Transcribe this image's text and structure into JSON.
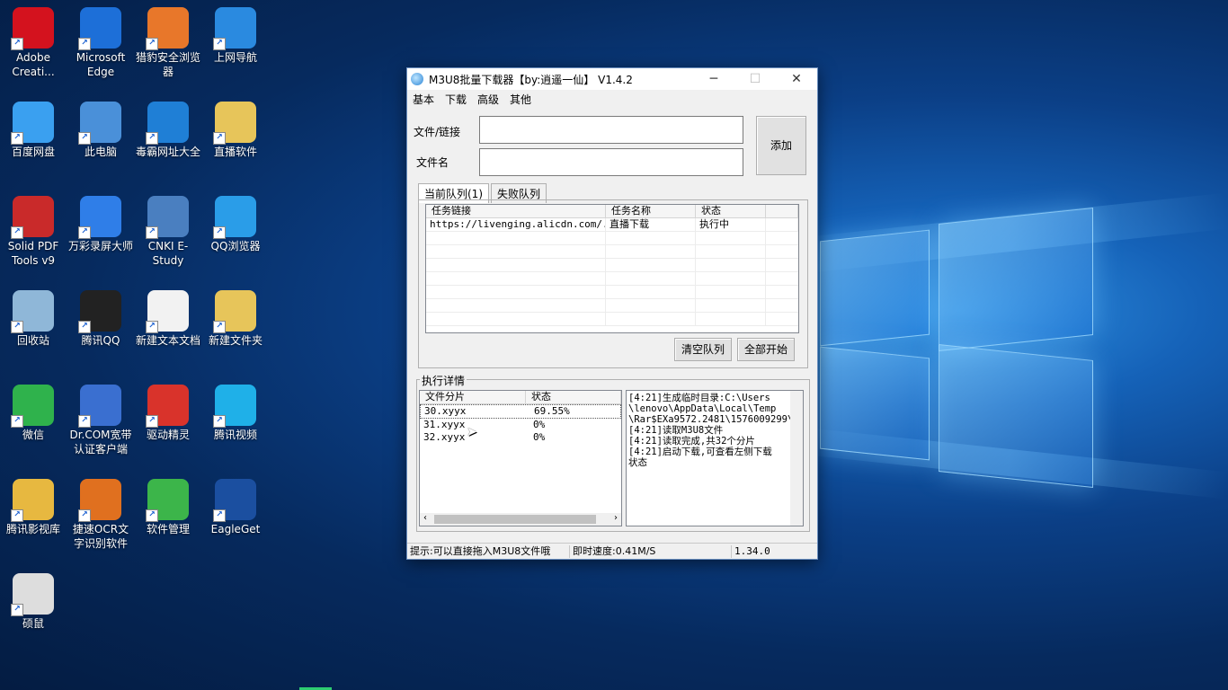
{
  "desktop": {
    "icons": [
      {
        "label": "Adobe Creati...",
        "icon": "adobe-cc-icon",
        "color": "#d4121e"
      },
      {
        "label": "Microsoft Edge",
        "icon": "edge-icon",
        "color": "#1d6fd8"
      },
      {
        "label": "猎豹安全浏览器",
        "icon": "cheetah-browser-icon",
        "color": "#e8772a"
      },
      {
        "label": "上网导航",
        "icon": "ie-icon",
        "color": "#2a8ae0"
      },
      {
        "label": "百度网盘",
        "icon": "baidu-netdisk-icon",
        "color": "#3aa0f0"
      },
      {
        "label": "此电脑",
        "icon": "computer-icon",
        "color": "#4a90d9"
      },
      {
        "label": "毒霸网址大全",
        "icon": "ie-icon",
        "color": "#1f7fd6"
      },
      {
        "label": "直播软件",
        "icon": "folder-icon",
        "color": "#e7c55a"
      },
      {
        "label": "Solid PDF Tools v9",
        "icon": "pdf-icon",
        "color": "#c92a2a"
      },
      {
        "label": "万彩录屏大师",
        "icon": "screen-recorder-icon",
        "color": "#2f7ee8"
      },
      {
        "label": "CNKI E-Study",
        "icon": "notebook-icon",
        "color": "#4a7fc0"
      },
      {
        "label": "QQ浏览器",
        "icon": "qq-browser-icon",
        "color": "#2a9de8"
      },
      {
        "label": "回收站",
        "icon": "recycle-bin-icon",
        "color": "#8fb7d8"
      },
      {
        "label": "腾讯QQ",
        "icon": "qq-penguin-icon",
        "color": "#222222"
      },
      {
        "label": "新建文本文档",
        "icon": "text-document-icon",
        "color": "#f2f2f2"
      },
      {
        "label": "新建文件夹",
        "icon": "folder-icon",
        "color": "#e7c55a"
      },
      {
        "label": "微信",
        "icon": "wechat-icon",
        "color": "#2fb24c"
      },
      {
        "label": "Dr.COM宽带认证客户端",
        "icon": "network-shield-icon",
        "color": "#3a6fd0"
      },
      {
        "label": "驱动精灵",
        "icon": "driver-genius-icon",
        "color": "#d9332b"
      },
      {
        "label": "腾讯视频",
        "icon": "tencent-video-icon",
        "color": "#1fb0e8"
      },
      {
        "label": "腾讯影视库",
        "icon": "folder-video-icon",
        "color": "#e7b840"
      },
      {
        "label": "捷速OCR文字识别软件",
        "icon": "ocr-icon",
        "color": "#e0701f"
      },
      {
        "label": "软件管理",
        "icon": "software-manager-icon",
        "color": "#3cb54a"
      },
      {
        "label": "EagleGet",
        "icon": "eagle-icon",
        "color": "#1b4fa0"
      },
      {
        "label": "硕鼠",
        "icon": "mouse-icon",
        "color": "#dddddd"
      }
    ]
  },
  "window": {
    "title": "M3U8批量下载器【by:逍遥一仙】 V1.4.2",
    "controls": {
      "minimize": "─",
      "maximize": "☐",
      "close": "✕"
    },
    "menu": [
      "基本",
      "下载",
      "高级",
      "其他"
    ],
    "file_label": "文件/链接",
    "name_label": "文件名",
    "file_value": "",
    "name_value": "",
    "add_button": "添加",
    "tabs": [
      "当前队列(1)",
      "失败队列"
    ],
    "queue": {
      "headers": [
        "任务链接",
        "任务名称",
        "状态"
      ],
      "rows": [
        [
          "https://livenging.alicdn.com/...",
          "直播下载",
          "执行中"
        ]
      ]
    },
    "clear_button": "清空队列",
    "start_all_button": "全部开始",
    "details_title": "执行详情",
    "segments": {
      "headers": [
        "文件分片",
        "状态"
      ],
      "rows": [
        [
          "30.xyyx",
          "69.55%"
        ],
        [
          "31.xyyx",
          "0%"
        ],
        [
          "32.xyyx",
          "0%"
        ]
      ]
    },
    "log": [
      "[4:21]生成临时目录:C:\\Users",
      "\\lenovo\\AppData\\Local\\Temp",
      "\\Rar$EXa9572.2481\\1576009299\\",
      "[4:21]读取M3U8文件",
      "[4:21]读取完成,共32个分片",
      "[4:21]启动下载,可查看左侧下载",
      "状态"
    ],
    "status": {
      "hint": "提示:可以直接拖入M3U8文件哦",
      "speed": "即时速度:0.41M/S",
      "version": "1.34.0"
    }
  }
}
